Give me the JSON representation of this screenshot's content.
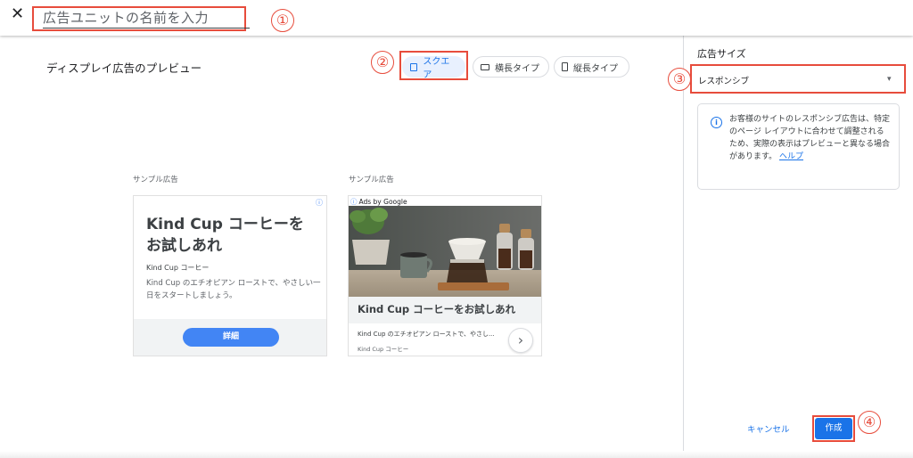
{
  "header": {
    "close_glyph": "✕",
    "name_placeholder": "広告ユニットの名前を入力"
  },
  "callouts": {
    "c1": "①",
    "c2": "②",
    "c3": "③",
    "c4": "④"
  },
  "preview": {
    "title": "ディスプレイ広告のプレビュー",
    "shape_options": [
      {
        "label": "スクエア",
        "selected": true
      },
      {
        "label": "横長タイプ",
        "selected": false
      },
      {
        "label": "縦長タイプ",
        "selected": false
      }
    ],
    "sample_label": "サンプル広告",
    "ad1": {
      "info_glyph": "ⓘ",
      "headline": "Kind Cup コーヒーを お試しあれ",
      "brand": "Kind Cup コーヒー",
      "description": "Kind Cup のエチオピアン ローストで、やさしい一日をスタートしましょう。",
      "button": "詳細"
    },
    "ad2": {
      "adsby": "Ads by Google",
      "headline": "Kind Cup コーヒーをお試しあれ",
      "description": "Kind Cup のエチオピアン ローストで、やさし...",
      "brand": "Kind Cup コーヒー",
      "next_glyph": "›"
    }
  },
  "sidebar": {
    "size_label": "広告サイズ",
    "size_value": "レスポンシブ",
    "caret": "▾",
    "info_text": "お客様のサイトのレスポンシブ広告は、特定のページ レイアウトに合わせて調整されるため、実際の表示はプレビューと異なる場合があります。",
    "help_link": "ヘルプ",
    "cancel": "キャンセル",
    "create": "作成"
  },
  "colors": {
    "accent": "#1a73e8",
    "annotation_red": "#e74c3c"
  }
}
